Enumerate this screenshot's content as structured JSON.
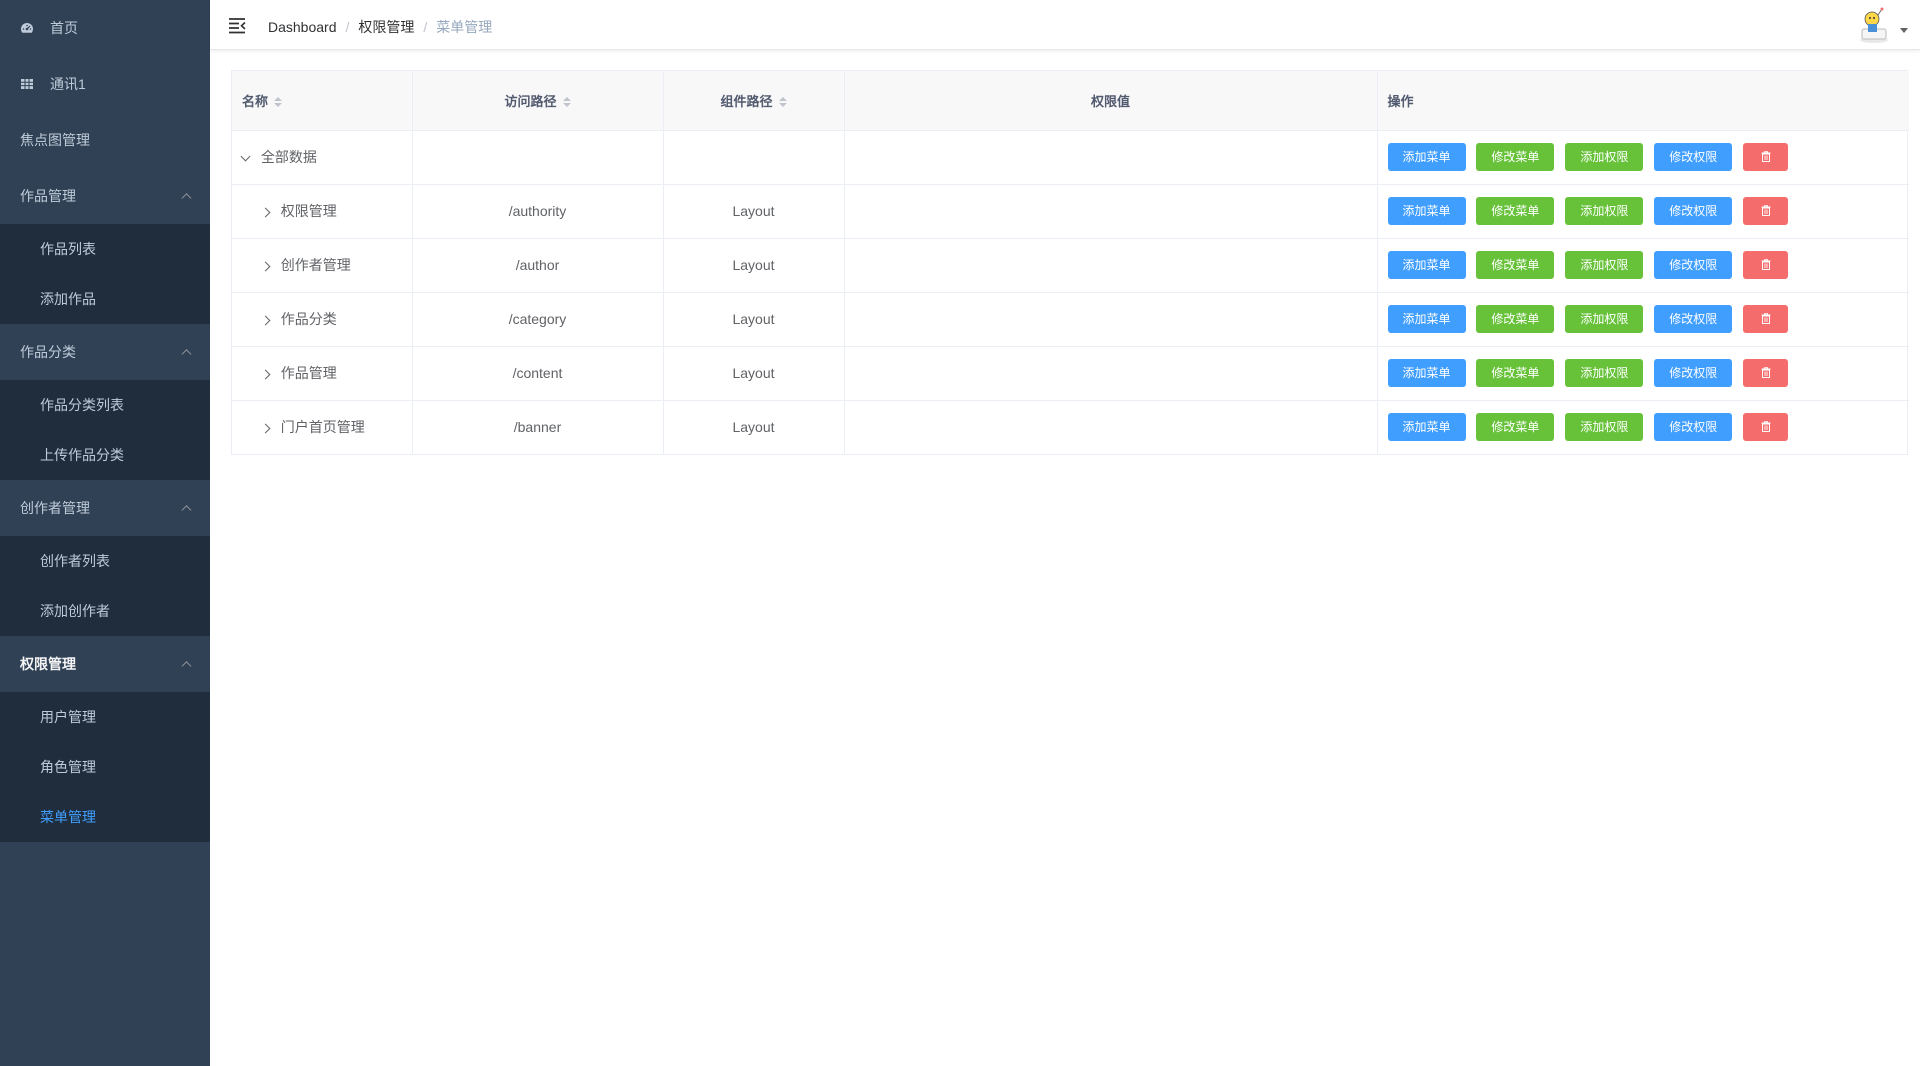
{
  "sidebar": {
    "items": [
      {
        "label": "首页",
        "icon": "dashboard-icon"
      },
      {
        "label": "通讯1",
        "icon": "table-icon"
      },
      {
        "label": "焦点图管理"
      }
    ],
    "groups": [
      {
        "title": "作品管理",
        "children": [
          "作品列表",
          "添加作品"
        ]
      },
      {
        "title": "作品分类",
        "children": [
          "作品分类列表",
          "上传作品分类"
        ]
      },
      {
        "title": "创作者管理",
        "children": [
          "创作者列表",
          "添加创作者"
        ]
      },
      {
        "title": "权限管理",
        "children": [
          "用户管理",
          "角色管理",
          "菜单管理"
        ]
      }
    ],
    "active_item": "菜单管理",
    "colors": {
      "bg": "#304156",
      "sub_bg": "#1f2d3d",
      "active": "#409eff"
    }
  },
  "header": {
    "breadcrumb": [
      "Dashboard",
      "权限管理",
      "菜单管理"
    ]
  },
  "table": {
    "columns": [
      "名称",
      "访问路径",
      "组件路径",
      "权限值",
      "操作"
    ],
    "rows": [
      {
        "name": "全部数据",
        "path": "",
        "component": "",
        "permission": ""
      },
      {
        "name": "权限管理",
        "path": "/authority",
        "component": "Layout",
        "permission": ""
      },
      {
        "name": "创作者管理",
        "path": "/author",
        "component": "Layout",
        "permission": ""
      },
      {
        "name": "作品分类",
        "path": "/category",
        "component": "Layout",
        "permission": ""
      },
      {
        "name": "作品管理",
        "path": "/content",
        "component": "Layout",
        "permission": ""
      },
      {
        "name": "门户首页管理",
        "path": "/banner",
        "component": "Layout",
        "permission": ""
      }
    ],
    "actions": {
      "add_menu": "添加菜单",
      "edit_menu": "修改菜单",
      "add_permission": "添加权限",
      "edit_permission": "修改权限",
      "delete_icon": "trash-icon"
    },
    "colors": {
      "primary": "#409eff",
      "success": "#67c23a",
      "danger": "#f56c6c"
    }
  }
}
